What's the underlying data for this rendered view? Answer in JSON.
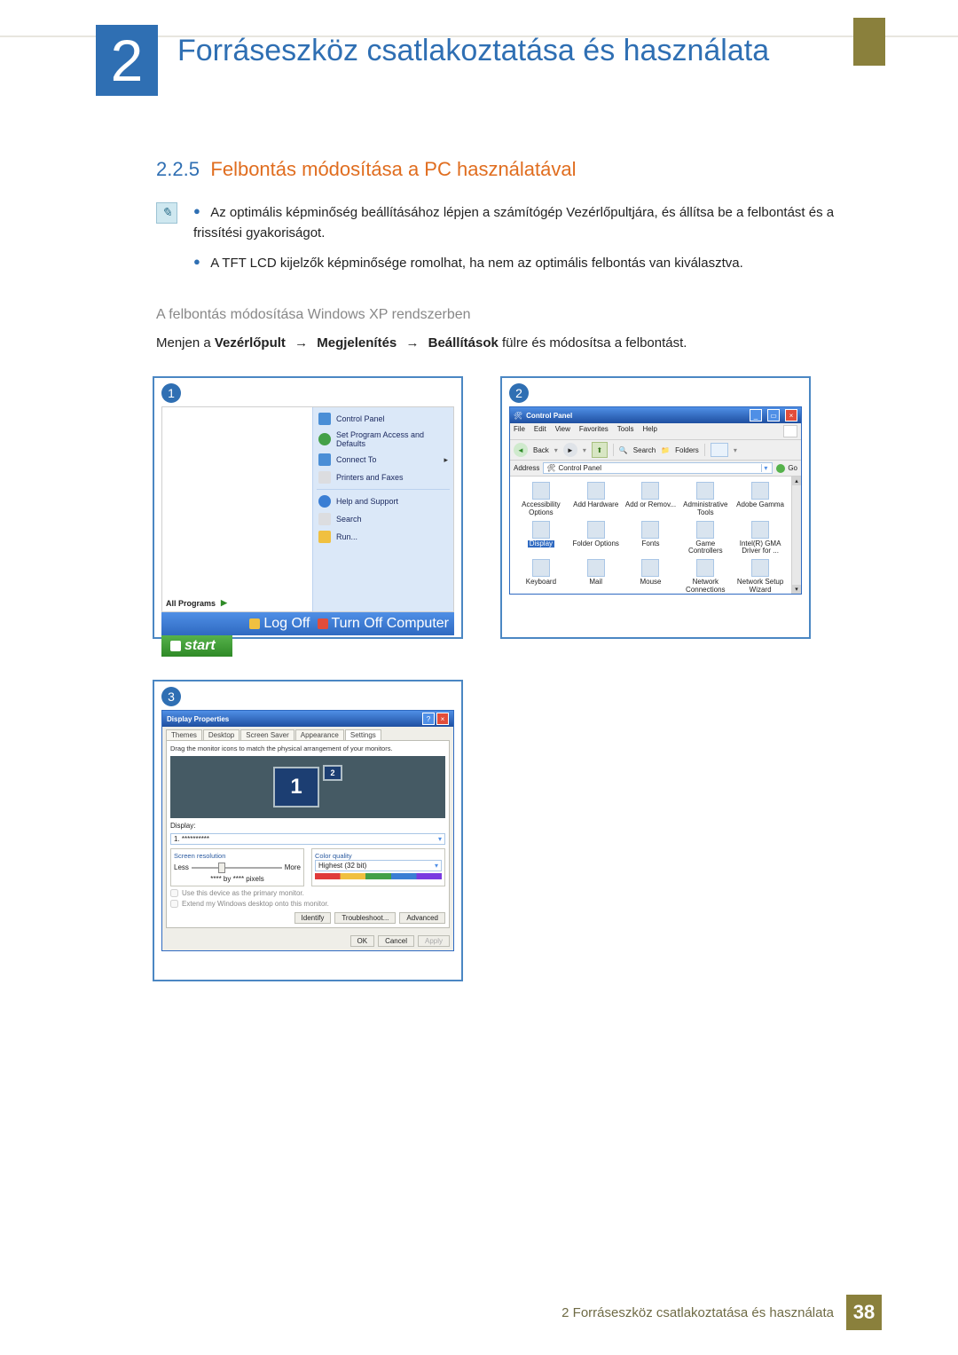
{
  "chapter": {
    "number": "2",
    "title": "Forráseszköz csatlakoztatása és használata"
  },
  "section": {
    "number": "2.2.5",
    "title": "Felbontás módosítása a PC használatával"
  },
  "notes": {
    "bullet1": "Az optimális képminőség beállításához lépjen a számítógép Vezérlőpultjára, és állítsa be a felbontást és a frissítési gyakoriságot.",
    "bullet2": "A TFT LCD kijelzők képminősége romolhat, ha nem az optimális felbontás van kiválasztva."
  },
  "subheading": "A felbontás módosítása Windows XP rendszerben",
  "instruction": {
    "pre": "Menjen a ",
    "a": "Vezérlőpult",
    "b": "Megjelenítés",
    "c": "Beállítások",
    "post": " fülre és módosítsa a felbontást.",
    "arrow": "→"
  },
  "step_labels": {
    "s1": "1",
    "s2": "2",
    "s3": "3"
  },
  "start_menu": {
    "items": {
      "control_panel": "Control Panel",
      "program_access": "Set Program Access and Defaults",
      "connect_to": "Connect To",
      "printers_faxes": "Printers and Faxes",
      "help_support": "Help and Support",
      "search": "Search",
      "run": "Run..."
    },
    "all_programs": "All Programs",
    "log_off": "Log Off",
    "turn_off": "Turn Off Computer",
    "start": "start"
  },
  "control_panel": {
    "title": "Control Panel",
    "menu": {
      "file": "File",
      "edit": "Edit",
      "view": "View",
      "favorites": "Favorites",
      "tools": "Tools",
      "help": "Help"
    },
    "toolbar": {
      "back": "Back",
      "search": "Search",
      "folders": "Folders"
    },
    "address_label": "Address",
    "address_value": "Control Panel",
    "go": "Go",
    "icons": [
      {
        "label": "Accessibility Options"
      },
      {
        "label": "Add Hardware"
      },
      {
        "label": "Add or Remov..."
      },
      {
        "label": "Administrative Tools"
      },
      {
        "label": "Adobe Gamma"
      },
      {
        "label": "Display",
        "selected": true
      },
      {
        "label": "Folder Options"
      },
      {
        "label": "Fonts"
      },
      {
        "label": "Game Controllers"
      },
      {
        "label": "Intel(R) GMA Driver for ..."
      },
      {
        "label": "Keyboard"
      },
      {
        "label": "Mail"
      },
      {
        "label": "Mouse"
      },
      {
        "label": "Network Connections"
      },
      {
        "label": "Network Setup Wizard"
      }
    ]
  },
  "display_props": {
    "title": "Display Properties",
    "tabs": {
      "themes": "Themes",
      "desktop": "Desktop",
      "screensaver": "Screen Saver",
      "appearance": "Appearance",
      "settings": "Settings"
    },
    "desc": "Drag the monitor icons to match the physical arrangement of your monitors.",
    "mon1": "1",
    "mon2": "2",
    "display_label": "Display:",
    "display_value": "1. **********",
    "res": {
      "title": "Screen resolution",
      "less": "Less",
      "more": "More",
      "value": "**** by **** pixels"
    },
    "cq": {
      "title": "Color quality",
      "value": "Highest (32 bit)"
    },
    "chk1": "Use this device as the primary monitor.",
    "chk2": "Extend my Windows desktop onto this monitor.",
    "identify": "Identify",
    "troubleshoot": "Troubleshoot...",
    "advanced": "Advanced",
    "ok": "OK",
    "cancel": "Cancel",
    "apply": "Apply"
  },
  "footer": {
    "text": "2 Forráseszköz csatlakoztatása és használata",
    "page": "38"
  }
}
